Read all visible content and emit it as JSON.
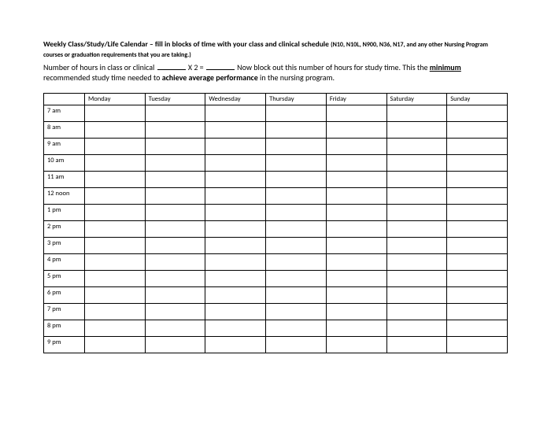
{
  "header": {
    "title_bold": "Weekly Class/Study/Life Calendar – fill in blocks of time with your class and clinical schedule ",
    "title_small": "(N10, N10L, N900, N36, N17, and any other Nursing Program courses or graduation requirements that you are taking.)"
  },
  "paragraph": {
    "part1": "Number of hours in class or clinical ",
    "mult": " X 2 = ",
    "part2": "   Now block out this number of hours for study time.  This the ",
    "minimum": "minimum",
    "part3": " recommended study time needed to ",
    "achieve": "achieve average performance",
    "part4": " in the nursing program."
  },
  "table": {
    "days": [
      "Monday",
      "Tuesday",
      "Wednesday",
      "Thursday",
      "Friday",
      "Saturday",
      "Sunday"
    ],
    "times": [
      "7 am",
      "8 am",
      "9 am",
      "10 am",
      "11 am",
      "12 noon",
      "1 pm",
      "2 pm",
      "3 pm",
      "4 pm",
      "5 pm",
      "6 pm",
      "7 pm",
      "8 pm",
      "9 pm"
    ]
  }
}
